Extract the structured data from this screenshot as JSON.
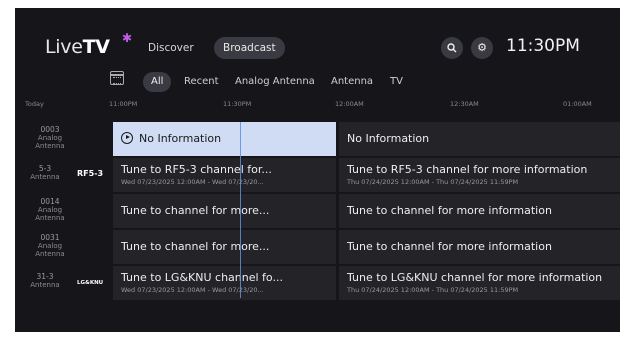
{
  "app": {
    "logo_text_a": "Live",
    "logo_text_b": "TV",
    "clock": "11:30PM"
  },
  "nav": {
    "discover": "Discover",
    "broadcast": "Broadcast"
  },
  "icons": {
    "search": "search-icon",
    "settings": "gear-icon",
    "calendar": "calendar-icon",
    "play": "play-icon"
  },
  "filters": {
    "all": "All",
    "recent": "Recent",
    "analog_antenna": "Analog Antenna",
    "antenna": "Antenna",
    "tv": "TV"
  },
  "timeline": {
    "today": "Today",
    "t1": "11:00PM",
    "t2": "11:30PM",
    "t3": "12:00AM",
    "t4": "12:30AM",
    "t5": "01:00AM"
  },
  "channels": [
    {
      "number": "0003",
      "type_a": "Analog",
      "type_b": "Antenna",
      "brand": ""
    },
    {
      "number": "5-3",
      "type_a": "Antenna",
      "type_b": "",
      "brand": "RF5-3"
    },
    {
      "number": "0014",
      "type_a": "Analog",
      "type_b": "Antenna",
      "brand": ""
    },
    {
      "number": "0031",
      "type_a": "Analog",
      "type_b": "Antenna",
      "brand": ""
    },
    {
      "number": "31-3",
      "type_a": "Antenna",
      "type_b": "",
      "brand": "LG&KNU"
    }
  ],
  "programs": [
    {
      "a": {
        "title": "No Information",
        "sub": ""
      },
      "b": {
        "title": "No Information",
        "sub": ""
      }
    },
    {
      "a": {
        "title": "Tune to RF5-3 channel for...",
        "sub": "Wed 07/23/2025 12:00AM - Wed 07/23/20..."
      },
      "b": {
        "title": "Tune to RF5-3 channel for more information",
        "sub": "Thu 07/24/2025 12:00AM - Thu 07/24/2025 11:59PM"
      }
    },
    {
      "a": {
        "title": "Tune to  channel for more...",
        "sub": ""
      },
      "b": {
        "title": "Tune to  channel for more information",
        "sub": ""
      }
    },
    {
      "a": {
        "title": "Tune to  channel for more...",
        "sub": ""
      },
      "b": {
        "title": "Tune to  channel for more information",
        "sub": ""
      }
    },
    {
      "a": {
        "title": "Tune to LG&KNU channel fo...",
        "sub": "Wed 07/23/2025 12:00AM - Wed 07/23/20..."
      },
      "b": {
        "title": "Tune to LG&KNU channel for more information",
        "sub": "Thu 07/24/2025 12:00AM - Thu 07/24/2025 11:59PM"
      }
    }
  ]
}
